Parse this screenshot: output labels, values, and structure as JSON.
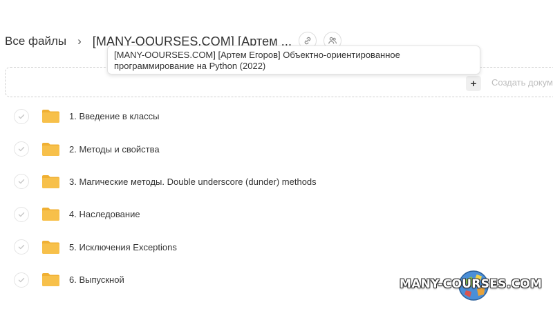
{
  "breadcrumb": {
    "root": "Все файлы",
    "separator": "›",
    "current": "[MANY-OOURSES.COM] [Артем ..."
  },
  "tooltip": {
    "text": "[MANY-OOURSES.COM] [Артем Егоров] Объектно-ориентированное программирование на Python (2022)"
  },
  "toolbar": {
    "create_plus": "+",
    "create_label": "Создать докум"
  },
  "files": [
    {
      "name": "1. Введение в классы",
      "icon": "folder-icon"
    },
    {
      "name": "2. Методы и свойства",
      "icon": "folder-icon"
    },
    {
      "name": "3. Магические методы. Double underscore (dunder) methods",
      "icon": "folder-icon"
    },
    {
      "name": "4. Наследование",
      "icon": "folder-icon"
    },
    {
      "name": "5. Исключения Exceptions",
      "icon": "folder-icon"
    },
    {
      "name": "6. Выпускной",
      "icon": "folder-icon"
    }
  ],
  "watermark": {
    "text": "MANY-COURSES.COM"
  },
  "colors": {
    "folder": "#f7c04a",
    "folder_tab": "#f0b033",
    "border": "#e4e4e4",
    "text": "#333333"
  }
}
